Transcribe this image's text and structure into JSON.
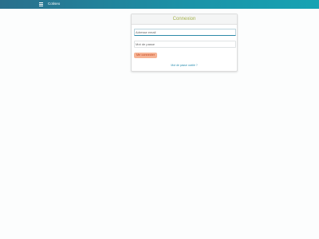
{
  "app": {
    "title": "Cotiseo"
  },
  "login": {
    "title": "Connexion",
    "email_label": "Adresse email",
    "password_label": "Mot de passe",
    "submit_label": "Me connecter",
    "forgot_label": "Mot de passe oublié ?"
  },
  "colors": {
    "topbar": "#1a93a8",
    "title_accent": "#a4b14a",
    "button_bg": "#f6b394",
    "button_text": "#c2451f",
    "link": "#2a8eb0"
  },
  "icons": {
    "menu": "hamburger-menu-icon"
  }
}
